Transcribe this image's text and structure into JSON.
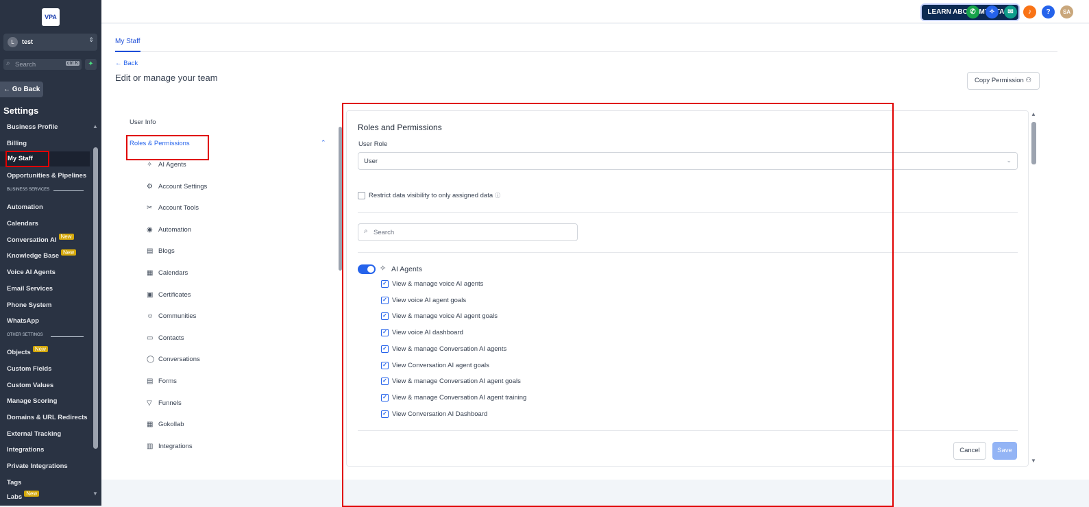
{
  "sidebar": {
    "logo_text": "VPA",
    "location": {
      "avatar": "L",
      "name": "test"
    },
    "search_placeholder": "Search",
    "search_shortcut": "ctrl K",
    "go_back": "← Go Back",
    "title": "Settings",
    "items": [
      {
        "label": "Business Profile"
      },
      {
        "label": "Billing"
      },
      {
        "label": "My Staff"
      },
      {
        "label": "Opportunities & Pipelines"
      }
    ],
    "section_business": "BUSINESS SERVICES",
    "business_items": [
      {
        "label": "Automation"
      },
      {
        "label": "Calendars"
      },
      {
        "label": "Conversation AI",
        "badge": "New"
      },
      {
        "label": "Knowledge Base",
        "badge": "New"
      },
      {
        "label": "Voice AI Agents"
      },
      {
        "label": "Email Services"
      },
      {
        "label": "Phone System"
      },
      {
        "label": "WhatsApp"
      }
    ],
    "section_other": "OTHER SETTINGS",
    "other_items": [
      {
        "label": "Objects",
        "badge": "New"
      },
      {
        "label": "Custom Fields"
      },
      {
        "label": "Custom Values"
      },
      {
        "label": "Manage Scoring"
      },
      {
        "label": "Domains & URL Redirects"
      },
      {
        "label": "External Tracking"
      },
      {
        "label": "Integrations"
      },
      {
        "label": "Private Integrations"
      },
      {
        "label": "Tags"
      },
      {
        "label": "Labs",
        "badge": "New"
      }
    ]
  },
  "topbar": {
    "learn_button": "LEARN ABOUT MY STAFF",
    "avatar_initials": "SA",
    "help": "?"
  },
  "main": {
    "tab": "My Staff",
    "back": "← Back",
    "title": "Edit or manage your team",
    "copy_permission": "Copy Permission",
    "nav": {
      "user_info": "User Info",
      "roles": "Roles & Permissions",
      "children": [
        {
          "icon": "✧",
          "label": "AI Agents"
        },
        {
          "icon": "⚙",
          "label": "Account Settings"
        },
        {
          "icon": "✂",
          "label": "Account Tools"
        },
        {
          "icon": "◉",
          "label": "Automation"
        },
        {
          "icon": "▤",
          "label": "Blogs"
        },
        {
          "icon": "▦",
          "label": "Calendars"
        },
        {
          "icon": "▣",
          "label": "Certificates"
        },
        {
          "icon": "☺",
          "label": "Communities"
        },
        {
          "icon": "▭",
          "label": "Contacts"
        },
        {
          "icon": "◯",
          "label": "Conversations"
        },
        {
          "icon": "▤",
          "label": "Forms"
        },
        {
          "icon": "▽",
          "label": "Funnels"
        },
        {
          "icon": "▦",
          "label": "Gokollab"
        },
        {
          "icon": "▥",
          "label": "Integrations"
        }
      ]
    },
    "panel": {
      "title": "Roles and Permissions",
      "role_label": "User Role",
      "role_value": "User",
      "restrict_label": "Restrict data visibility to only assigned data",
      "search_placeholder": "Search",
      "group": "AI Agents",
      "permissions": [
        "View & manage voice AI agents",
        "View voice AI agent goals",
        "View & manage voice AI agent goals",
        "View voice AI dashboard",
        "View & manage Conversation AI agents",
        "View Conversation AI agent goals",
        "View & manage Conversation AI agent goals",
        "View & manage Conversation AI agent training",
        "View Conversation AI Dashboard"
      ],
      "cancel": "Cancel",
      "save": "Save"
    }
  },
  "colors": {
    "sidebar": "#2a3343",
    "accent": "#2563eb",
    "highlight": "#e00000"
  }
}
